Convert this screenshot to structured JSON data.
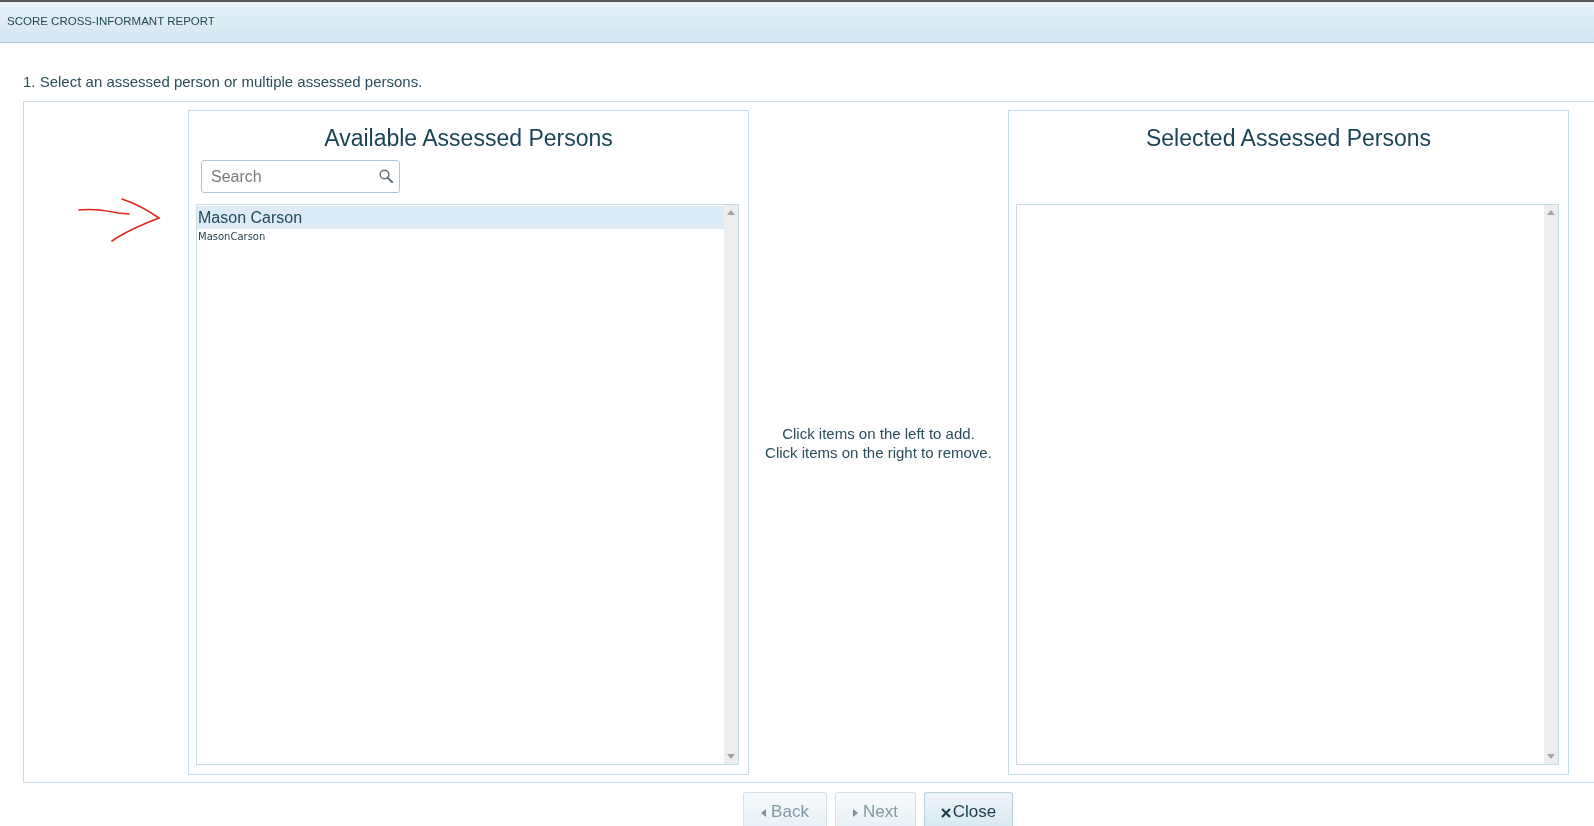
{
  "window": {
    "title": "SCORE CROSS-INFORMANT REPORT"
  },
  "step_instruction": "1. Select an assessed person or multiple assessed persons.",
  "available_panel": {
    "heading": "Available Assessed Persons",
    "search": {
      "placeholder": "Search"
    },
    "items": [
      {
        "name": "Mason Carson",
        "username": "MasonCarson",
        "selected": true
      }
    ]
  },
  "hint_lines": [
    "Click items on the left to add.",
    "Click items on the right to remove."
  ],
  "selected_panel": {
    "heading": "Selected Assessed Persons"
  },
  "buttons": [
    {
      "label": "Back",
      "kind": "back",
      "disabled": true
    },
    {
      "label": "Next",
      "kind": "next",
      "disabled": true
    },
    {
      "label": "Close",
      "kind": "close",
      "disabled": false
    }
  ]
}
